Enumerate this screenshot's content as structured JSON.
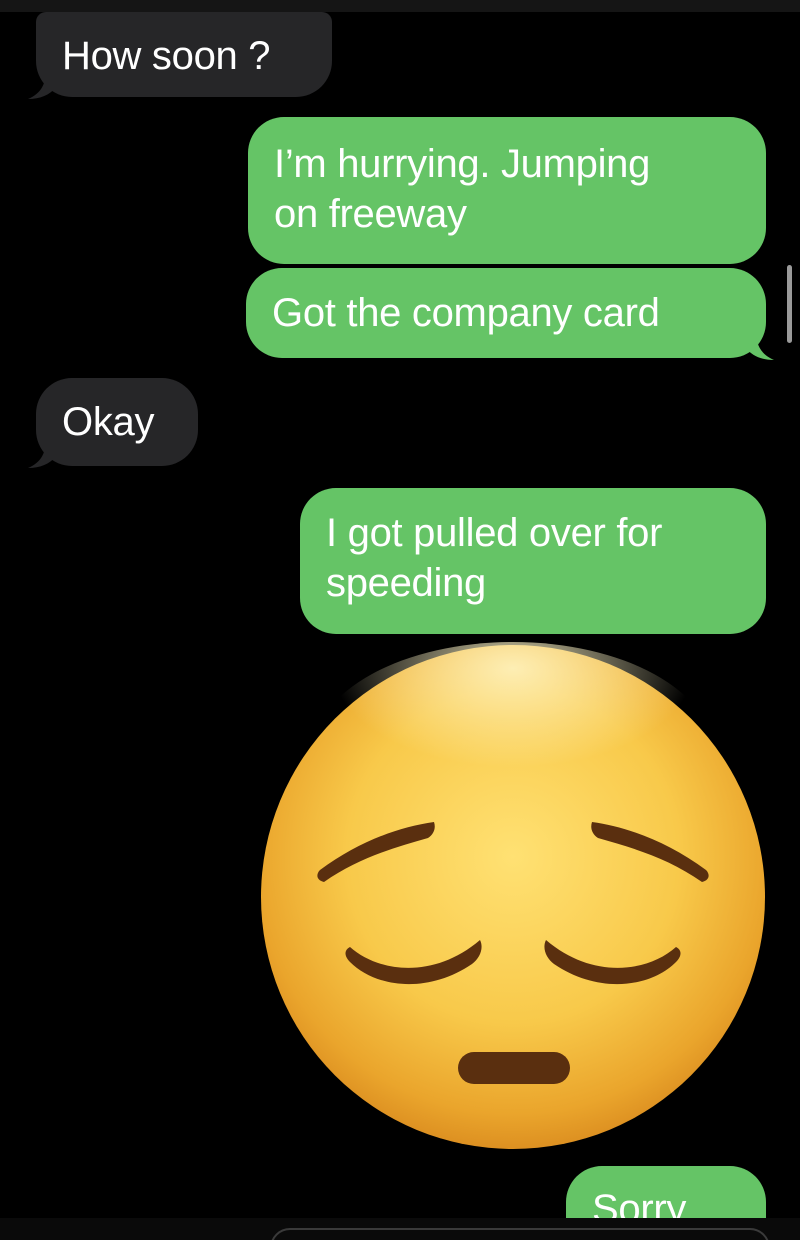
{
  "conversation": {
    "messages": [
      {
        "direction": "incoming",
        "text": "How soon ?"
      },
      {
        "direction": "outgoing",
        "text_lines": [
          "I’m hurrying. Jumping",
          "on freeway"
        ]
      },
      {
        "direction": "outgoing",
        "text": "Got the company card"
      },
      {
        "direction": "incoming",
        "text": "Okay"
      },
      {
        "direction": "outgoing",
        "text_lines": [
          "I got pulled over for",
          "speeding"
        ]
      },
      {
        "direction": "outgoing",
        "type": "emoji",
        "icon": "pensive-face-emoji"
      },
      {
        "direction": "outgoing",
        "text": "Sorry"
      }
    ]
  },
  "colors": {
    "background": "#000000",
    "incoming_bubble": "#262628",
    "outgoing_bubble": "#65c466",
    "text": "#ffffff"
  }
}
